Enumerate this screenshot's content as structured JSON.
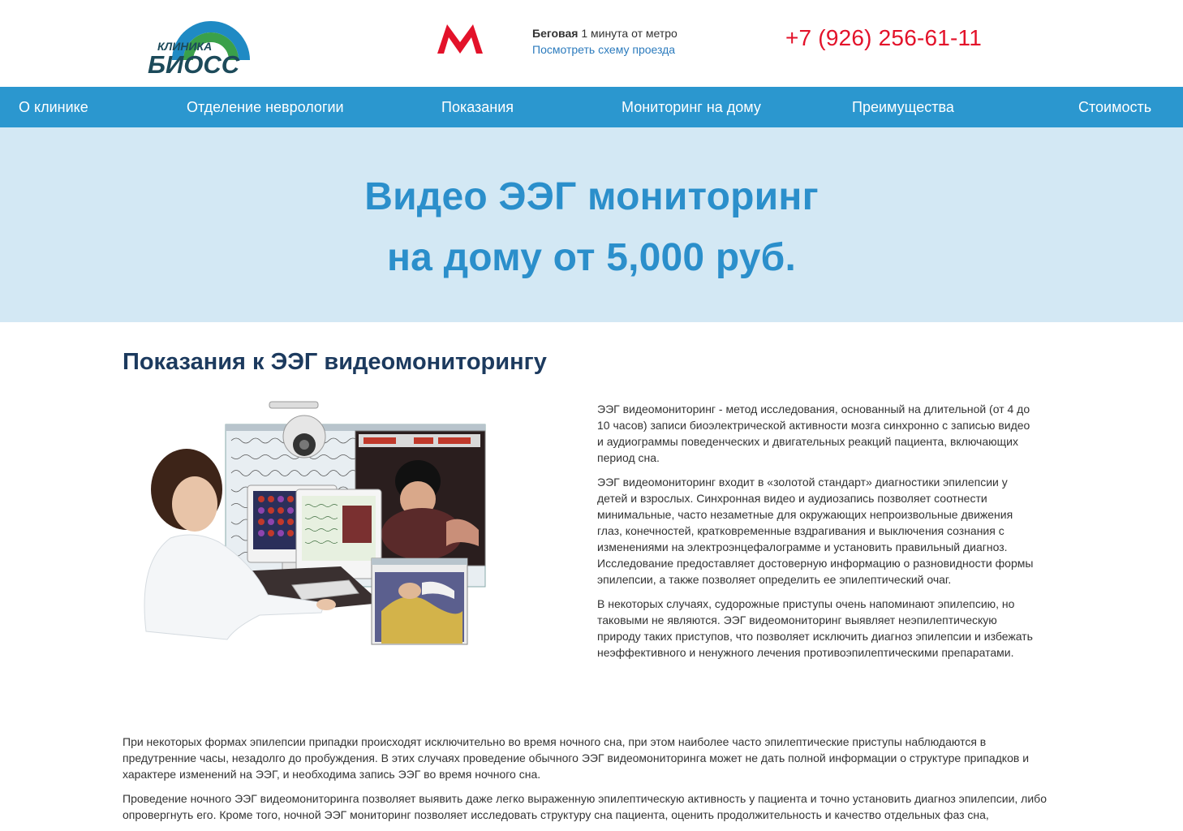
{
  "header": {
    "logo_small": "КЛИНИКА",
    "logo_big": "БИОСС",
    "metro_station": "Беговая",
    "metro_distance": "1 минута от метро",
    "route_link": "Посмотреть схему проезда",
    "phone": "+7 (926) 256-61-11",
    "metro_color": "#e3122a"
  },
  "nav": {
    "items": [
      {
        "label": "О клинике"
      },
      {
        "label": "Отделение неврологии"
      },
      {
        "label": "Показания"
      },
      {
        "label": "Мониторинг на дому"
      },
      {
        "label": "Преимущества"
      },
      {
        "label": "Стоимость"
      }
    ],
    "background": "#2b97cf"
  },
  "hero": {
    "line1": "Видео ЭЭГ мониторинг",
    "line2": "на дому от 5,000 руб.",
    "background": "#d3e8f4",
    "text_color": "#2b8fcb"
  },
  "main": {
    "title": "Показания к ЭЭГ видеомониторингу",
    "paragraphs": [
      "ЭЭГ видеомониторинг - метод исследования, основанный на длительной (от 4 до 10 часов) записи биоэлектрической активности мозга синхронно с записью видео и аудиограммы поведенческих и двигательных реакций пациента, включающих период сна.",
      "ЭЭГ видеомониторинг входит в «золотой стандарт» диагностики эпилепсии у детей и взрослых. Синхронная видео и аудиозапись позволяет соотнести минимальные, часто незаметные для окружающих непроизвольные движения глаз, конечностей, кратковременные вздрагивания и выключения сознания с изменениями на электроэнцефалограмме и установить правильный диагноз. Исследование предоставляет достоверную информацию о разновидности формы эпилепсии, а также позволяет определить ее эпилептический очаг.",
      "В некоторых случаях, судорожные приступы очень напоминают эпилепсию, но таковыми не являются. ЭЭГ видеомониторинг выявляет неэпилептическую природу таких приступов, что позволяет исключить диагноз эпилепсии и избежать неэффективного и ненужного лечения противоэпилептическими препаратами."
    ],
    "bottom_paragraphs": [
      "При некоторых формах эпилепсии припадки происходят исключительно во время ночного сна, при этом наиболее часто эпилептические приступы наблюдаются в предутренние часы, незадолго до пробуждения. В этих случаях проведение обычного ЭЭГ видеомониторинга может не дать полной информации о структуре припадков и характере изменений на ЭЭГ, и необходима запись ЭЭГ во время ночного сна.",
      "Проведение ночного ЭЭГ видеомониторинга позволяет выявить даже легко выраженную эпилептическую активность у пациента и точно установить диагноз эпилепсии, либо опровергнуть его. Кроме того, ночной ЭЭГ мониторинг позволяет исследовать структуру сна пациента, оценить продолжительность и качество отдельных фаз сна,"
    ]
  }
}
